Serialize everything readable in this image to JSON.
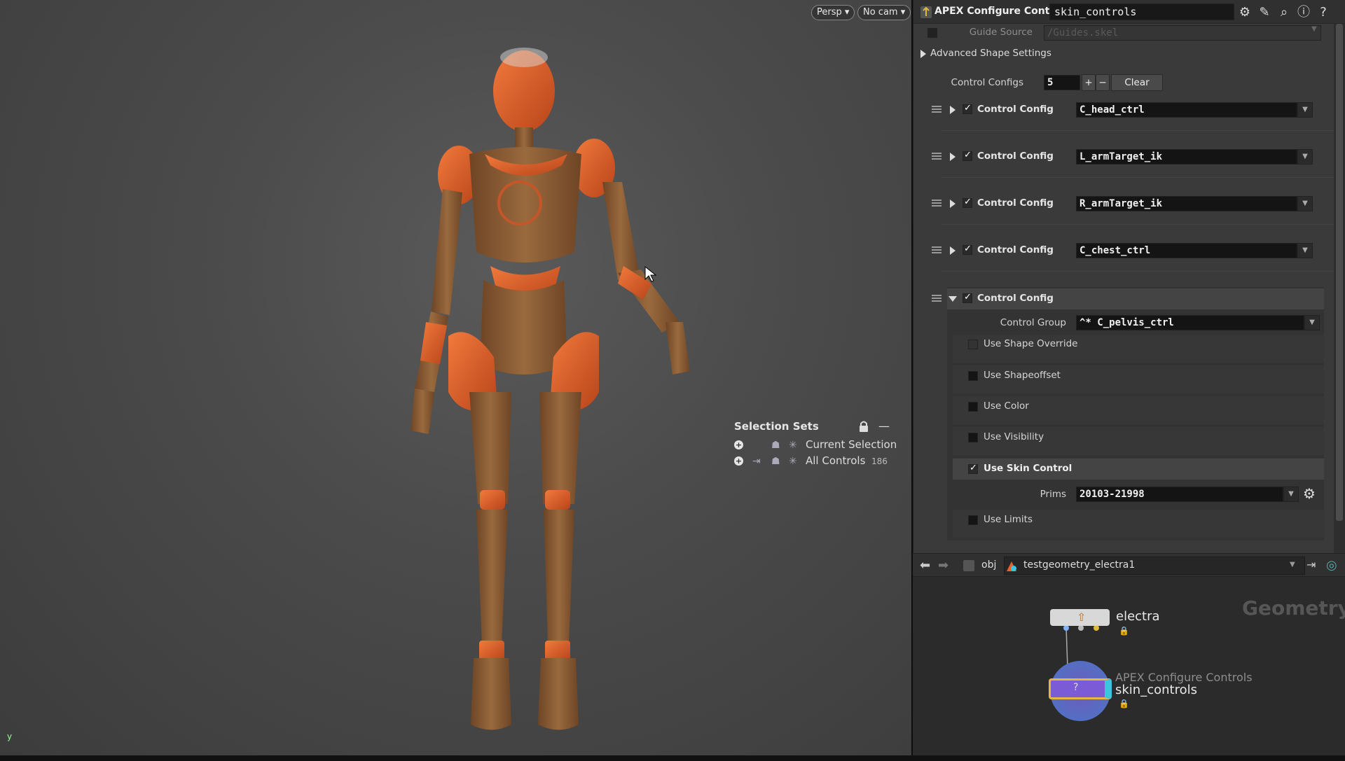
{
  "viewport": {
    "persp_label": "Persp",
    "cam_label": "No cam",
    "axis_label": "y",
    "selection_sets": {
      "title": "Selection Sets",
      "rows": [
        {
          "label": "Current Selection",
          "count": ""
        },
        {
          "label": "All Controls",
          "count": "186"
        }
      ]
    }
  },
  "params": {
    "node_type": "APEX Configure Controls",
    "node_name": "skin_controls",
    "toolbar_icons": [
      "gear-icon",
      "brush-icon",
      "search-icon",
      "info-icon",
      "help-icon"
    ],
    "guide_source": {
      "label": "Guide Source",
      "placeholder": "/Guides.skel"
    },
    "advanced_shape_settings": "Advanced Shape Settings",
    "control_configs": {
      "label": "Control Configs",
      "value": "5",
      "add": "+",
      "remove": "−",
      "clear": "Clear"
    },
    "configs": [
      {
        "label": "Control Config",
        "value": "C_head_ctrl"
      },
      {
        "label": "Control Config",
        "value": "L_armTarget_ik"
      },
      {
        "label": "Control Config",
        "value": "R_armTarget_ik"
      },
      {
        "label": "Control Config",
        "value": "C_chest_ctrl"
      }
    ],
    "expanded": {
      "label": "Control Config",
      "control_group_label": "Control Group",
      "control_group_value": "^* C_pelvis_ctrl",
      "options": [
        {
          "label": "Use Shape Override",
          "checked": false
        },
        {
          "label": "Use Shapeoffset",
          "checked": false
        },
        {
          "label": "Use Color",
          "checked": false
        },
        {
          "label": "Use Visibility",
          "checked": false
        },
        {
          "label": "Use Skin Control",
          "checked": true
        }
      ],
      "prims_label": "Prims",
      "prims_value": "20103-21998",
      "use_limits": "Use Limits"
    }
  },
  "network": {
    "path_root": "obj",
    "path_node": "testgeometry_electra1",
    "context": "Geometry",
    "nodes": [
      {
        "name": "electra",
        "type": ""
      },
      {
        "name": "skin_controls",
        "type": "APEX Configure Controls"
      }
    ]
  },
  "colors": {
    "accent": "#e2b840",
    "node_purple": "#7c5cd6",
    "node_cyan": "#3fc4e0",
    "robot_orange": "#e8612a",
    "robot_wood": "#8a5a32"
  }
}
